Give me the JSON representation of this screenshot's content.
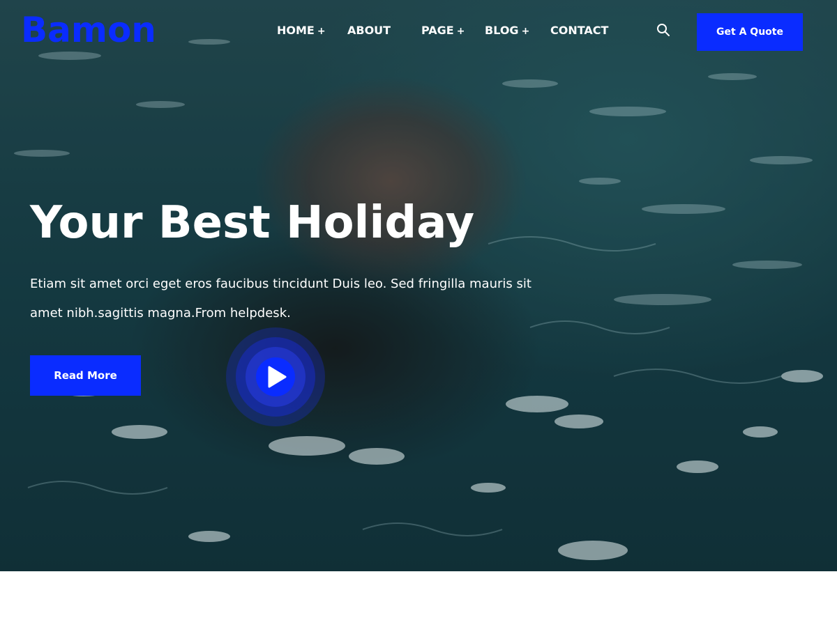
{
  "brand": {
    "logo_text": "Bamon",
    "accent_color": "#0a2cff"
  },
  "nav": {
    "items": [
      {
        "label": "HOME",
        "has_submenu": true,
        "submenu_marker": "+"
      },
      {
        "label": "ABOUT",
        "has_submenu": false,
        "submenu_marker": ""
      },
      {
        "label": "PAGE",
        "has_submenu": true,
        "submenu_marker": "+"
      },
      {
        "label": "BLOG",
        "has_submenu": true,
        "submenu_marker": "+"
      },
      {
        "label": "CONTACT",
        "has_submenu": false,
        "submenu_marker": ""
      }
    ],
    "search_icon": "search-icon",
    "cta_label": "Get A Quote"
  },
  "hero": {
    "headline": "Your Best Holiday",
    "description": "Etiam sit amet orci eget eros faucibus tincidunt Duis leo. Sed fringilla mauris sit amet nibh.sagittis magna.From helpdesk.",
    "read_more_label": "Read More",
    "play_icon": "play-icon"
  }
}
